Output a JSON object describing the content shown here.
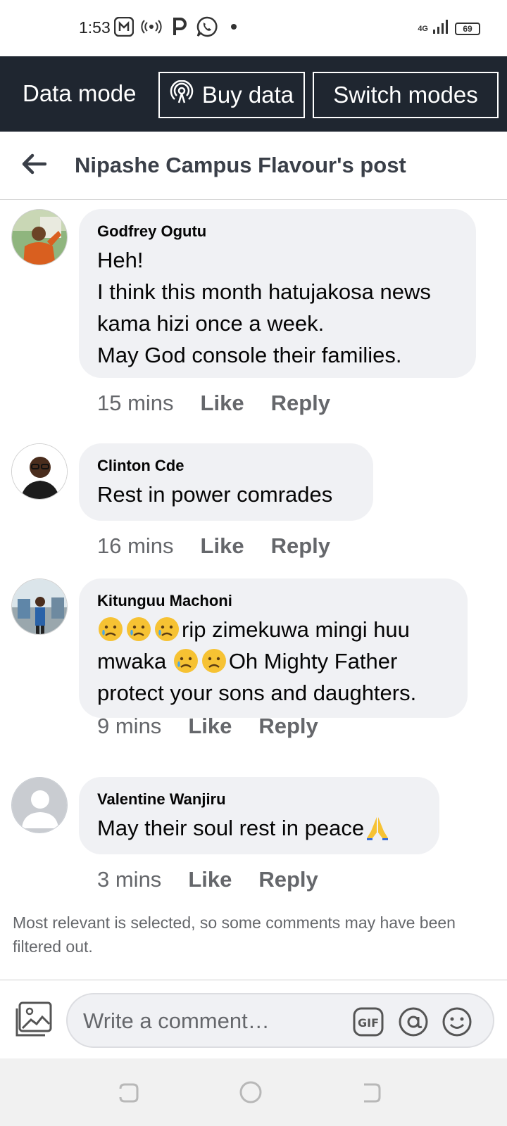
{
  "status_bar": {
    "time": "1:53",
    "network": "4G",
    "battery": "69",
    "icons": [
      "app-icon",
      "hotspot-icon",
      "p-icon",
      "whatsapp-icon",
      "dot-icon",
      "signal-icon",
      "battery-icon"
    ]
  },
  "data_bar": {
    "mode_label": "Data mode",
    "buy_label": "Buy data",
    "switch_label": "Switch modes"
  },
  "header": {
    "title": "Nipashe Campus Flavour's post"
  },
  "comments": [
    {
      "name": "Godfrey Ogutu",
      "text": "Heh!\nI think this month hatujakosa news kama hizi once a week.\nMay God console their families.",
      "time": "15 mins",
      "like": "Like",
      "reply": "Reply"
    },
    {
      "name": "Clinton Cde",
      "text": "Rest in power comrades",
      "time": "16 mins",
      "like": "Like",
      "reply": "Reply"
    },
    {
      "name": "Kitunguu Machoni",
      "text_parts": [
        "rip zimekuwa mingi huu mwaka ",
        "Oh Mighty Father protect your sons and daughters."
      ],
      "time": "9 mins",
      "like": "Like",
      "reply": "Reply"
    },
    {
      "name": "Valentine Wanjiru",
      "text": "May their soul rest in peace",
      "time": "3 mins",
      "like": "Like",
      "reply": "Reply"
    }
  ],
  "filter_note": "Most relevant is selected, so some comments may have been filtered out.",
  "composer": {
    "placeholder": "Write a comment…",
    "gif_label": "GIF"
  },
  "colors": {
    "data_bar_bg": "#1f2630",
    "bubble_bg": "#f0f1f4",
    "meta_text": "#65676b"
  }
}
